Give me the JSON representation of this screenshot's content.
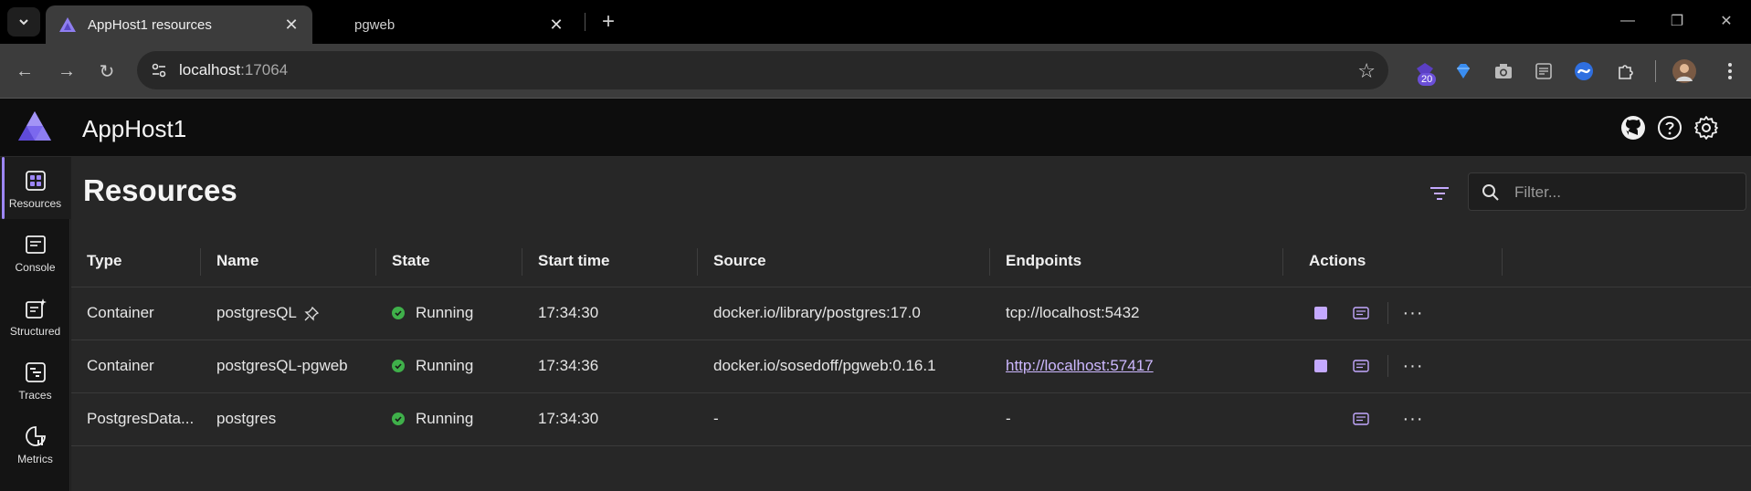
{
  "browser": {
    "tabs": [
      {
        "title": "AppHost1 resources",
        "active": true
      },
      {
        "title": "pgweb",
        "active": false
      }
    ],
    "url_host": "localhost",
    "url_port": ":17064",
    "extension_badge": "20"
  },
  "app": {
    "title": "AppHost1",
    "accent_color": "#9d86f7"
  },
  "sidebar": {
    "items": [
      {
        "label": "Resources",
        "icon": "resources-icon",
        "selected": true
      },
      {
        "label": "Console",
        "icon": "console-icon",
        "selected": false
      },
      {
        "label": "Structured",
        "icon": "structured-logs-icon",
        "selected": false
      },
      {
        "label": "Traces",
        "icon": "traces-icon",
        "selected": false
      },
      {
        "label": "Metrics",
        "icon": "metrics-icon",
        "selected": false
      }
    ]
  },
  "page": {
    "title": "Resources",
    "filter_placeholder": "Filter..."
  },
  "table": {
    "headers": [
      "Type",
      "Name",
      "State",
      "Start time",
      "Source",
      "Endpoints",
      "Actions"
    ],
    "rows": [
      {
        "type": "Container",
        "name": "postgresQL",
        "state": "Running",
        "start": "17:34:30",
        "source": "docker.io/library/postgres:17.0",
        "endpoint": "tcp://localhost:5432"
      },
      {
        "type": "Container",
        "name": "postgresQL-pgweb",
        "state": "Running",
        "start": "17:34:36",
        "source": "docker.io/sosedoff/pgweb:0.16.1",
        "endpoint": "http://localhost:57417"
      },
      {
        "type": "PostgresData...",
        "name": "postgres",
        "state": "Running",
        "start": "17:34:30",
        "source": "-",
        "endpoint": "-"
      }
    ]
  }
}
